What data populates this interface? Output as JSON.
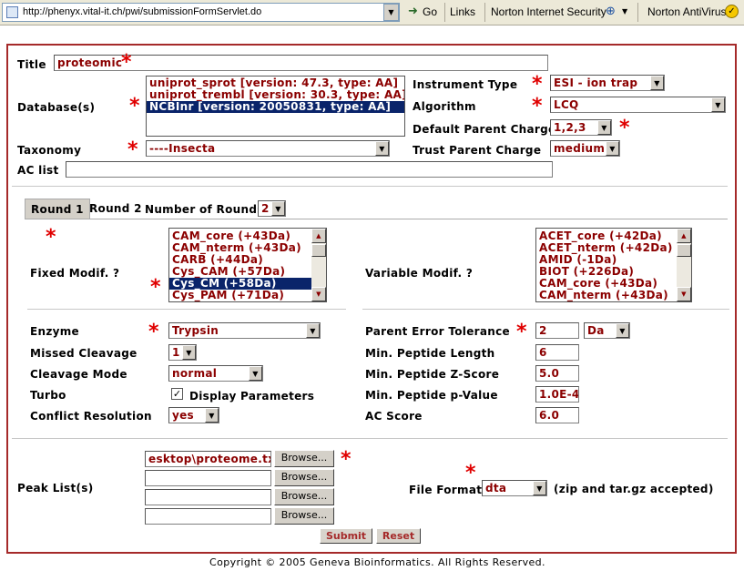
{
  "browser": {
    "address": "http://phenyx.vital-it.ch/pwi/submissionFormServlet.do",
    "go_label": "Go",
    "links_label": "Links",
    "norton_security": "Norton Internet Security",
    "norton_antivirus": "Norton AntiVirus"
  },
  "form": {
    "title_label": "Title",
    "title_value": "proteomic",
    "database_label": "Database(s)",
    "databases": [
      "uniprot_sprot [version: 47.3, type: AA]",
      "uniprot_trembl [version: 30.3, type: AA]",
      "NCBInr [version: 20050831, type: AA]"
    ],
    "database_selected_index": 2,
    "instrument_label": "Instrument Type",
    "instrument_value": "ESI - ion trap",
    "algorithm_label": "Algorithm",
    "algorithm_value": "LCQ",
    "charge_label": "Default Parent Charge",
    "charge_value": "1,2,3",
    "taxonomy_label": "Taxonomy",
    "taxonomy_value": "----Insecta",
    "trust_label": "Trust Parent Charge",
    "trust_value": "medium",
    "ac_list_label": "AC list",
    "ac_list_value": ""
  },
  "rounds": {
    "tabs": [
      "Round 1",
      "Round 2"
    ],
    "active_tab_index": 0,
    "number_label": "Number of Rounds",
    "number_value": "2",
    "fixed_label": "Fixed Modif. ?",
    "fixed_options": [
      "CAM_core (+43Da)",
      "CAM_nterm (+43Da)",
      "CARB (+44Da)",
      "Cys_CAM (+57Da)",
      "Cys_CM (+58Da)",
      "Cys_PAM (+71Da)"
    ],
    "fixed_selected_indices": [
      3,
      4
    ],
    "variable_label": "Variable Modif. ?",
    "variable_options": [
      "ACET_core (+42Da)",
      "ACET_nterm (+42Da)",
      "AMID (-1Da)",
      "BIOT (+226Da)",
      "CAM_core (+43Da)",
      "CAM_nterm (+43Da)"
    ],
    "enzyme_label": "Enzyme",
    "enzyme_value": "Trypsin",
    "missed_label": "Missed Cleavage",
    "missed_value": "1",
    "cleavage_label": "Cleavage Mode",
    "cleavage_value": "normal",
    "turbo_label": "Turbo",
    "display_params_label": "Display Parameters",
    "display_params_checked": "✓",
    "conflict_label": "Conflict Resolution",
    "conflict_value": "yes",
    "pet_label": "Parent Error Tolerance",
    "pet_value": "2",
    "pet_unit": "Da",
    "min_len_label": "Min. Peptide Length",
    "min_len_value": "6",
    "min_z_label": "Min. Peptide Z-Score",
    "min_z_value": "5.0",
    "min_p_label": "Min. Peptide p-Value",
    "min_p_value": "1.0E-4",
    "ac_score_label": "AC Score",
    "ac_score_value": "6.0"
  },
  "peak": {
    "label": "Peak List(s)",
    "files": [
      "esktop\\proteome.txt",
      "",
      "",
      ""
    ],
    "browse_label": "Browse...",
    "format_label": "File Format",
    "format_value": "dta",
    "format_note": "(zip and tar.gz accepted)"
  },
  "actions": {
    "submit": "Submit",
    "reset": "Reset"
  },
  "footer": "Copyright © 2005 Geneva Bioinformatics. All Rights Reserved.",
  "colors": {
    "frame": "#a52a2a",
    "required": "#e00000",
    "value_text": "#8b0000",
    "selection": "#0a246a"
  }
}
